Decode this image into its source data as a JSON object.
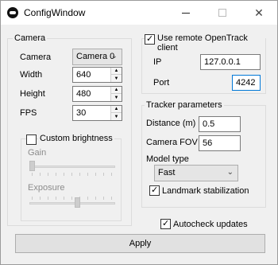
{
  "window": {
    "title": "ConfigWindow",
    "icon": "app-icon",
    "controls": {
      "minimize": "—",
      "maximize": "",
      "close": "✕"
    }
  },
  "camera": {
    "legend": "Camera",
    "camera_label": "Camera",
    "camera_value": "Camera 0",
    "width_label": "Width",
    "width_value": "640",
    "height_label": "Height",
    "height_value": "480",
    "fps_label": "FPS",
    "fps_value": "30",
    "brightness": {
      "checkbox_label": "Custom brightness",
      "checked": false,
      "gain_label": "Gain",
      "gain_level": 0,
      "exposure_label": "Exposure",
      "exposure_level": 0.56
    }
  },
  "remote": {
    "checkbox_label": "Use remote OpenTrack client",
    "checked": true,
    "ip_label": "IP",
    "ip_value": "127.0.0.1",
    "port_label": "Port",
    "port_value": "4242"
  },
  "tracker": {
    "legend": "Tracker parameters",
    "distance_label": "Distance (m)",
    "distance_value": "0.5",
    "fov_label": "Camera FOV",
    "fov_value": "56",
    "model_label": "Model type",
    "model_value": "Fast",
    "landmark_label": "Landmark stabilization",
    "landmark_checked": true
  },
  "autocheck": {
    "label": "Autocheck updates",
    "checked": true
  },
  "apply_label": "Apply",
  "spin_up": "▲",
  "spin_down": "▼",
  "dropdown_arrow": "⌄"
}
